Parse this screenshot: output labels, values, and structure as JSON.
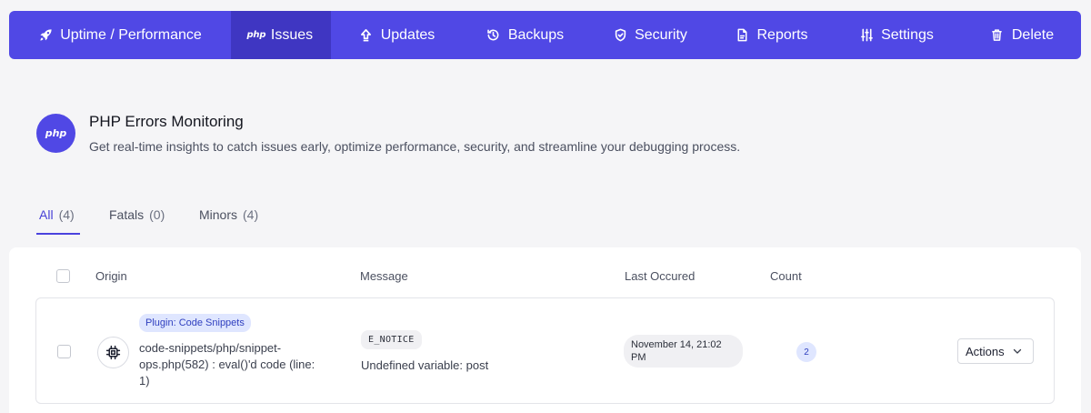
{
  "nav": {
    "items": [
      {
        "label": "Uptime / Performance",
        "icon": "rocket-icon",
        "active": false
      },
      {
        "label": "Issues",
        "icon": "php-icon",
        "active": true
      },
      {
        "label": "Updates",
        "icon": "upload-arrow-icon",
        "active": false
      },
      {
        "label": "Backups",
        "icon": "history-icon",
        "active": false
      },
      {
        "label": "Security",
        "icon": "shield-icon",
        "active": false
      },
      {
        "label": "Reports",
        "icon": "document-icon",
        "active": false
      },
      {
        "label": "Settings",
        "icon": "sliders-icon",
        "active": false
      },
      {
        "label": "Delete",
        "icon": "trash-icon",
        "active": false
      }
    ],
    "php_icon_text": "php",
    "accent": "#5048e5",
    "active_bg": "#3f36c2"
  },
  "header": {
    "badge_text": "php",
    "title": "PHP Errors Monitoring",
    "subtitle": "Get real-time insights to catch issues early, optimize performance, security, and streamline your debugging process."
  },
  "filters": [
    {
      "label": "All",
      "count": "(4)",
      "active": true
    },
    {
      "label": "Fatals",
      "count": "(0)",
      "active": false
    },
    {
      "label": "Minors",
      "count": "(4)",
      "active": false
    }
  ],
  "table": {
    "columns": {
      "origin": "Origin",
      "message": "Message",
      "last_occured": "Last Occured",
      "count": "Count"
    },
    "rows": [
      {
        "plugin_tag": "Plugin: Code Snippets",
        "origin_icon": "chip-icon",
        "origin": "code-snippets/php/snippet-ops.php(582) : eval()'d code (line: 1)",
        "level": "E_NOTICE",
        "message": "Undefined variable: post",
        "last_occured": "November 14, 21:02 PM",
        "count": "2",
        "actions_label": "Actions"
      }
    ]
  }
}
